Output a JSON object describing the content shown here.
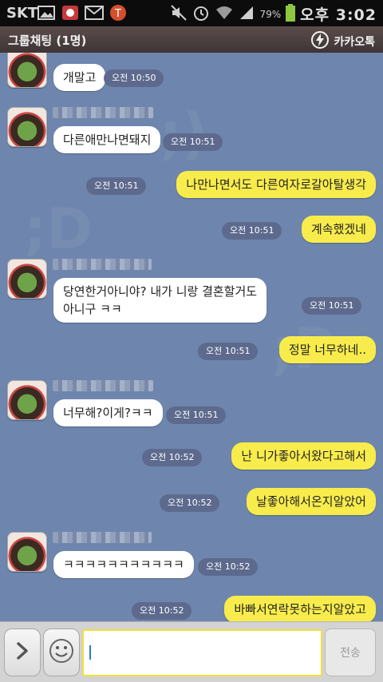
{
  "status_bar": {
    "carrier": "SKT",
    "icons_left": [
      "image-icon",
      "notification-icon",
      "mail-icon",
      "t-app-icon"
    ],
    "icons_right": [
      "mute-icon",
      "alarm-icon",
      "wifi-icon",
      "signal-icon"
    ],
    "battery_percent": "79%",
    "time": "오후 3:02"
  },
  "title_bar": {
    "title": "그룹채팅 (1명)",
    "app_name": "카카오톡"
  },
  "messages": [
    {
      "side": "in",
      "text": "개말고",
      "time": "오전 10:50"
    },
    {
      "side": "in",
      "text": "다른애만나면돼지",
      "time": "오전 10:51"
    },
    {
      "side": "out",
      "text": "나만나면서도 다른여자로갈아탈생각",
      "time": "오전 10:51"
    },
    {
      "side": "out",
      "text": "계속했겠네",
      "time": "오전 10:51"
    },
    {
      "side": "in",
      "text": "당연한거아니야? 내가 니랑 결혼할거도\n아니구 ㅋㅋ",
      "time": "오전 10:51"
    },
    {
      "side": "out",
      "text": "정말 너무하네..",
      "time": "오전 10:51"
    },
    {
      "side": "in",
      "text": "너무해?이게?ㅋㅋ",
      "time": "오전 10:51"
    },
    {
      "side": "out",
      "text": "난 니가좋아서왔다고해서",
      "time": "오전 10:52"
    },
    {
      "side": "out",
      "text": "날좋아해서온지알았어",
      "time": "오전 10:52"
    },
    {
      "side": "in",
      "text": "ㅋㅋㅋㅋㅋㅋㅋㅋㅋㅋㅋ",
      "time": "오전 10:52"
    },
    {
      "side": "out",
      "text": "바빠서연락못하는지알았고",
      "time": "오전 10:52"
    }
  ],
  "input_bar": {
    "expand_icon": "chevron-right-icon",
    "emoticon_icon": "smiley-icon",
    "input_value": "",
    "send_label": "전송"
  },
  "colors": {
    "chat_background": "#6e86ad",
    "outgoing_bubble": "#f8ec4c",
    "incoming_bubble": "#ffffff",
    "title_bar": "#4a3f3f",
    "input_border": "#f1df3a"
  }
}
